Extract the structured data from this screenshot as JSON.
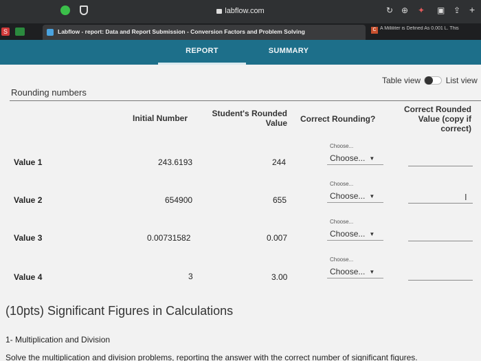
{
  "browser": {
    "url": "labflow.com",
    "tab_title": "Labflow - report: Data and Report Submission - Conversion Factors and Problem Solving",
    "other_tab_title": "A Milliliter is Defined As 0.001 L. This",
    "other_tab_favicon": "C",
    "left_favicon": "S"
  },
  "nav": {
    "report": "REPORT",
    "summary": "SUMMARY"
  },
  "view_toggle": {
    "left": "Table view",
    "right": "List view"
  },
  "section": {
    "title": "Rounding numbers"
  },
  "table": {
    "headers": {
      "initial": "Initial Number",
      "rounded_line1": "Student's Rounded",
      "rounded_line2": "Value",
      "correct": "Correct Rounding?",
      "copy_line1": "Correct Rounded",
      "copy_line2": "Value (copy if",
      "copy_line3": "correct)"
    },
    "rows": [
      {
        "label": "Value 1",
        "initial": "243.6193",
        "rounded": "244",
        "hint": "Choose...",
        "select": "Choose..."
      },
      {
        "label": "Value 2",
        "initial": "654900",
        "rounded": "655",
        "hint": "Choose...",
        "select": "Choose..."
      },
      {
        "label": "Value 3",
        "initial": "0.00731582",
        "rounded": "0.007",
        "hint": "Choose...",
        "select": "Choose..."
      },
      {
        "label": "Value 4",
        "initial": "3",
        "rounded": "3.00",
        "hint": "Choose...",
        "select": "Choose..."
      }
    ]
  },
  "section2": {
    "title": "(10pts) Significant Figures in Calculations",
    "subtitle": "1- Multiplication and Division",
    "instructions": "Solve the multiplication and division problems, reporting the answer with the correct number of significant figures."
  },
  "colors": {
    "nav_bg": "#1d6f8a",
    "page_bg": "#f2f2f2"
  }
}
